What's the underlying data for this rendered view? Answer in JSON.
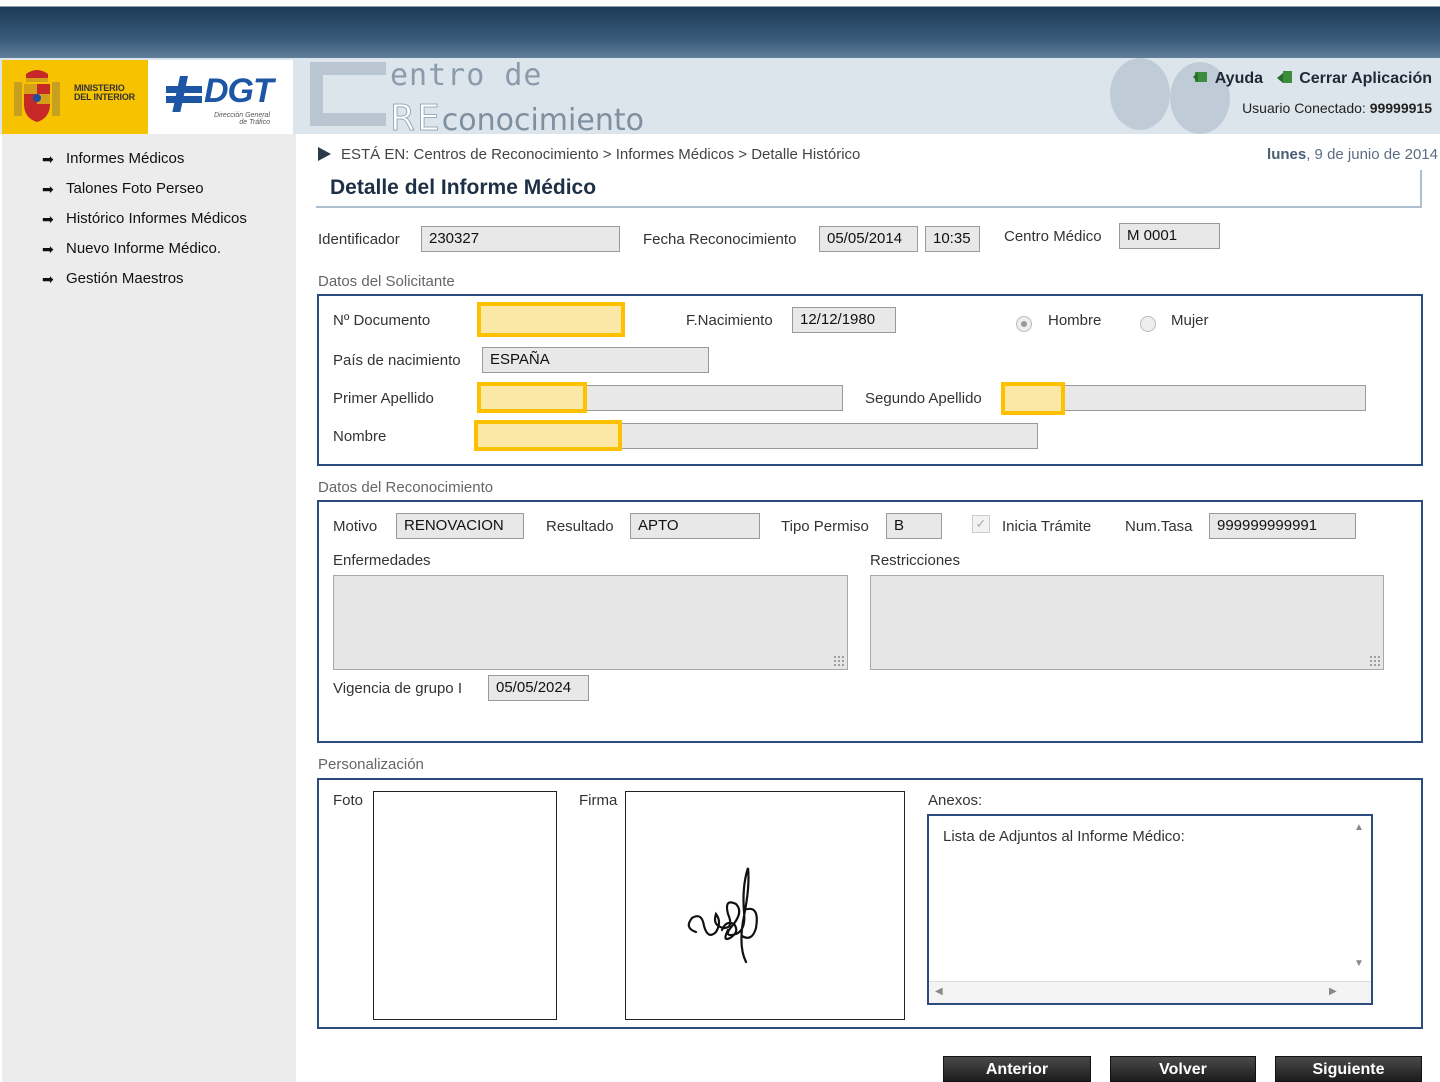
{
  "header": {
    "ministry_line1": "MINISTERIO",
    "ministry_line2": "DEL INTERIOR",
    "dgt_logo": "DGT",
    "dgt_sub1": "Dirección General",
    "dgt_sub2": "de Tráfico",
    "app_line1": "entro de",
    "app_big_re": "RE",
    "app_line2": "conocimiento",
    "help_label": "Ayuda",
    "close_label": "Cerrar Aplicación",
    "user_label": "Usuario Conectado:",
    "user_id": "99999915"
  },
  "sidebar": {
    "items": [
      {
        "label": "Informes Médicos"
      },
      {
        "label": "Talones Foto Perseo"
      },
      {
        "label": "Histórico Informes Médicos"
      },
      {
        "label": "Nuevo Informe Médico."
      },
      {
        "label": "Gestión Maestros"
      }
    ]
  },
  "breadcrumb": {
    "prefix": "ESTÁ EN:",
    "path": "Centros de Reconocimiento > Informes Médicos > Detalle Histórico"
  },
  "date": {
    "weekday": "lunes",
    "rest": ", 9 de junio de 2014"
  },
  "page_title": "Detalle del Informe Médico",
  "top_fields": {
    "id_label": "Identificador",
    "id_value": "230327",
    "fecha_label": "Fecha Reconocimiento",
    "fecha_value": "05/05/2014",
    "hora_value": "10:35",
    "centro_label": "Centro Médico",
    "centro_value": "M 0001"
  },
  "solicitante": {
    "section_title": "Datos del Solicitante",
    "doc_label": "Nº Documento",
    "fnac_label": "F.Nacimiento",
    "fnac_value": "12/12/1980",
    "hombre_label": "Hombre",
    "mujer_label": "Mujer",
    "sexo_selected": "Hombre",
    "pais_label": "País de nacimiento",
    "pais_value": "ESPAÑA",
    "apellido1_label": "Primer Apellido",
    "apellido2_label": "Segundo Apellido",
    "nombre_label": "Nombre"
  },
  "reconocimiento": {
    "section_title": "Datos del Reconocimiento",
    "motivo_label": "Motivo",
    "motivo_value": "RENOVACION",
    "resultado_label": "Resultado",
    "resultado_value": "APTO",
    "tipo_label": "Tipo Permiso",
    "tipo_value": "B",
    "inicia_label": "Inicia Trámite",
    "inicia_checked": true,
    "tasa_label": "Num.Tasa",
    "tasa_value": "999999999991",
    "enfermedades_label": "Enfermedades",
    "restricciones_label": "Restricciones",
    "vigencia_label": "Vigencia de grupo I",
    "vigencia_value": "05/05/2024"
  },
  "personalizacion": {
    "section_title": "Personalización",
    "foto_label": "Foto",
    "firma_label": "Firma",
    "anexos_label": "Anexos:",
    "anexos_list_text": "Lista de Adjuntos al Informe Médico:"
  },
  "buttons": {
    "prev": "Anterior",
    "back": "Volver",
    "next": "Siguiente"
  },
  "colors": {
    "accent_yellow": "#ffc000",
    "panel_border": "#2c4c7e",
    "title": "#1d3046"
  }
}
